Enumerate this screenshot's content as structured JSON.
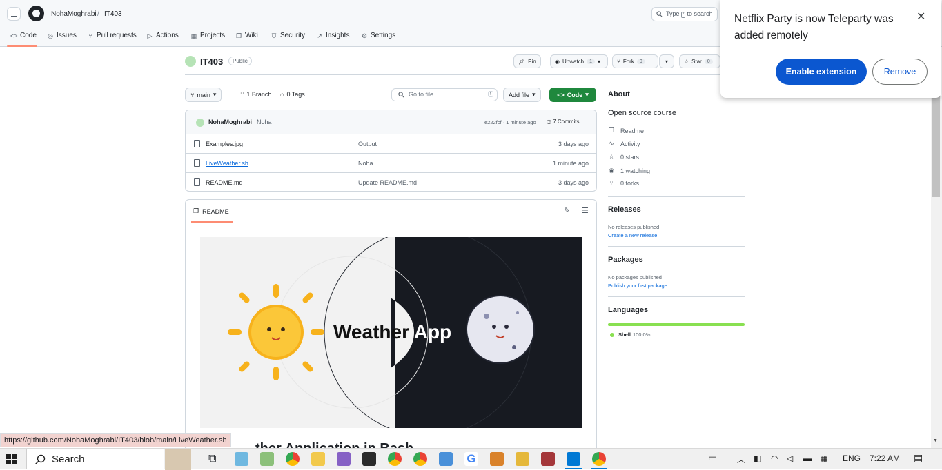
{
  "header": {
    "owner": "NohaMoghrabi",
    "repo": "IT403",
    "search_placeholder_pre": "Type",
    "search_key": "/",
    "search_placeholder_post": "to search"
  },
  "nav": {
    "tabs": [
      {
        "label": "Code",
        "icon": "code-icon"
      },
      {
        "label": "Issues",
        "icon": "issue-icon"
      },
      {
        "label": "Pull requests",
        "icon": "pull-request-icon"
      },
      {
        "label": "Actions",
        "icon": "play-icon"
      },
      {
        "label": "Projects",
        "icon": "table-icon"
      },
      {
        "label": "Wiki",
        "icon": "book-icon"
      },
      {
        "label": "Security",
        "icon": "shield-icon"
      },
      {
        "label": "Insights",
        "icon": "graph-icon"
      },
      {
        "label": "Settings",
        "icon": "gear-icon"
      }
    ],
    "active": "Code"
  },
  "repo": {
    "name": "IT403",
    "visibility": "Public",
    "pin_label": "Pin",
    "unwatch_label": "Unwatch",
    "unwatch_count": "1",
    "fork_label": "Fork",
    "fork_count": "0",
    "star_label": "Star",
    "star_count": "0"
  },
  "branch_bar": {
    "branch": "main",
    "branches": "1 Branch",
    "tags": "0 Tags",
    "goto_placeholder": "Go to file",
    "goto_key": "t",
    "add_file": "Add file",
    "code": "Code"
  },
  "commit": {
    "author": "NohaMoghrabi",
    "message": "Noha",
    "hash_time": "e222fcf · 1 minute ago",
    "commits": "7 Commits"
  },
  "files": [
    {
      "name": "Examples.jpg",
      "message": "Output",
      "date": "3 days ago"
    },
    {
      "name": "LiveWeather.sh",
      "message": "Noha",
      "date": "1 minute ago"
    },
    {
      "name": "README.md",
      "message": "Update README.md",
      "date": "3 days ago"
    }
  ],
  "readme": {
    "tab": "README",
    "banner_word1": "Weather",
    "banner_word2": "App",
    "heading_partial": "ther Application in Bash"
  },
  "sidebar": {
    "about_title": "About",
    "description": "Open source course",
    "items": [
      {
        "icon": "book-icon",
        "label": "Readme"
      },
      {
        "icon": "pulse-icon",
        "label": "Activity"
      },
      {
        "icon": "star-icon",
        "label": "0 stars"
      },
      {
        "icon": "eye-icon",
        "label": "1 watching"
      },
      {
        "icon": "fork-icon",
        "label": "0 forks"
      }
    ],
    "releases_title": "Releases",
    "releases_none": "No releases published",
    "releases_link": "Create a new release",
    "packages_title": "Packages",
    "packages_none": "No packages published",
    "packages_link": "Publish your first package",
    "languages_title": "Languages",
    "language_name": "Shell",
    "language_pct": "100.0%",
    "language_color": "#89e051"
  },
  "popup": {
    "title": "Netflix Party is now Teleparty was added remotely",
    "primary": "Enable extension",
    "secondary": "Remove"
  },
  "status_url": "https://github.com/NohaMoghrabi/IT403/blob/main/LiveWeather.sh",
  "taskbar": {
    "search": "Search",
    "lang": "ENG",
    "time": "7:22 AM"
  }
}
